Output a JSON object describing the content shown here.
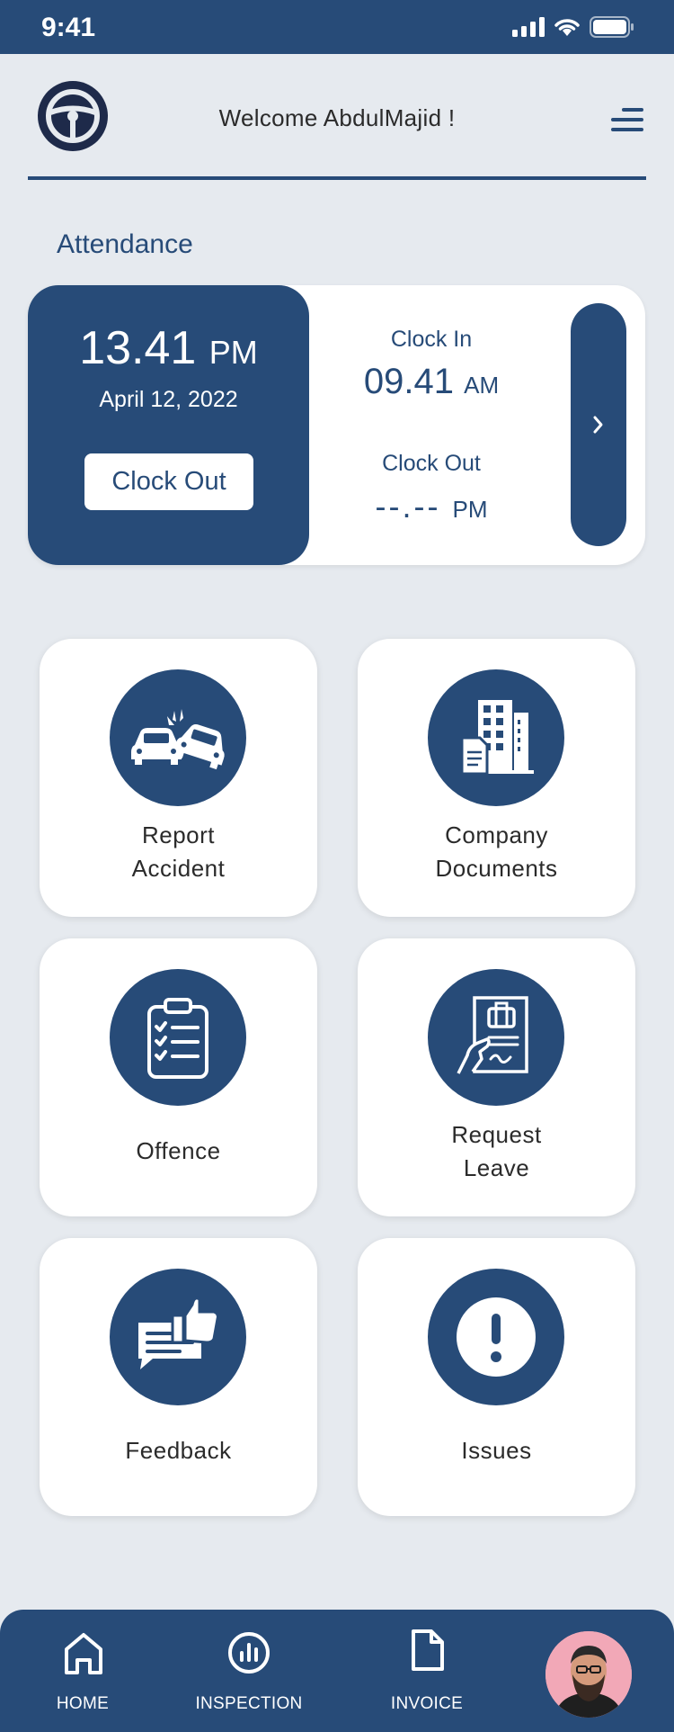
{
  "status": {
    "time": "9:41"
  },
  "header": {
    "welcome": "Welcome AbdulMajid !"
  },
  "attendance": {
    "title": "Attendance",
    "current_time": "13.41",
    "current_ampm": "PM",
    "date": "April 12, 2022",
    "button_label": "Clock Out",
    "clock_in_label": "Clock In",
    "clock_in_time": "09.41",
    "clock_in_ampm": "AM",
    "clock_out_label": "Clock Out",
    "clock_out_time": "--.--",
    "clock_out_ampm": "PM",
    "next_glyph": "›"
  },
  "tiles": [
    {
      "label_1": "Report",
      "label_2": "Accident",
      "icon": "car-accident-icon"
    },
    {
      "label_1": "Company",
      "label_2": "Documents",
      "icon": "documents-building-icon"
    },
    {
      "label": "Offence",
      "icon": "clipboard-checklist-icon"
    },
    {
      "label_1": "Request",
      "label_2": "Leave",
      "icon": "leave-request-icon"
    },
    {
      "label": "Feedback",
      "icon": "feedback-icon"
    },
    {
      "label": "Issues",
      "icon": "exclamation-icon"
    }
  ],
  "nav": {
    "items": [
      {
        "label": "HOME",
        "icon": "home-icon"
      },
      {
        "label": "INSPECTION",
        "icon": "inspection-chart-icon"
      },
      {
        "label": "INVOICE",
        "icon": "invoice-file-icon"
      }
    ],
    "avatar": "avatar"
  },
  "colors": {
    "primary": "#274b78",
    "background": "#e6eaef",
    "card": "#ffffff"
  }
}
